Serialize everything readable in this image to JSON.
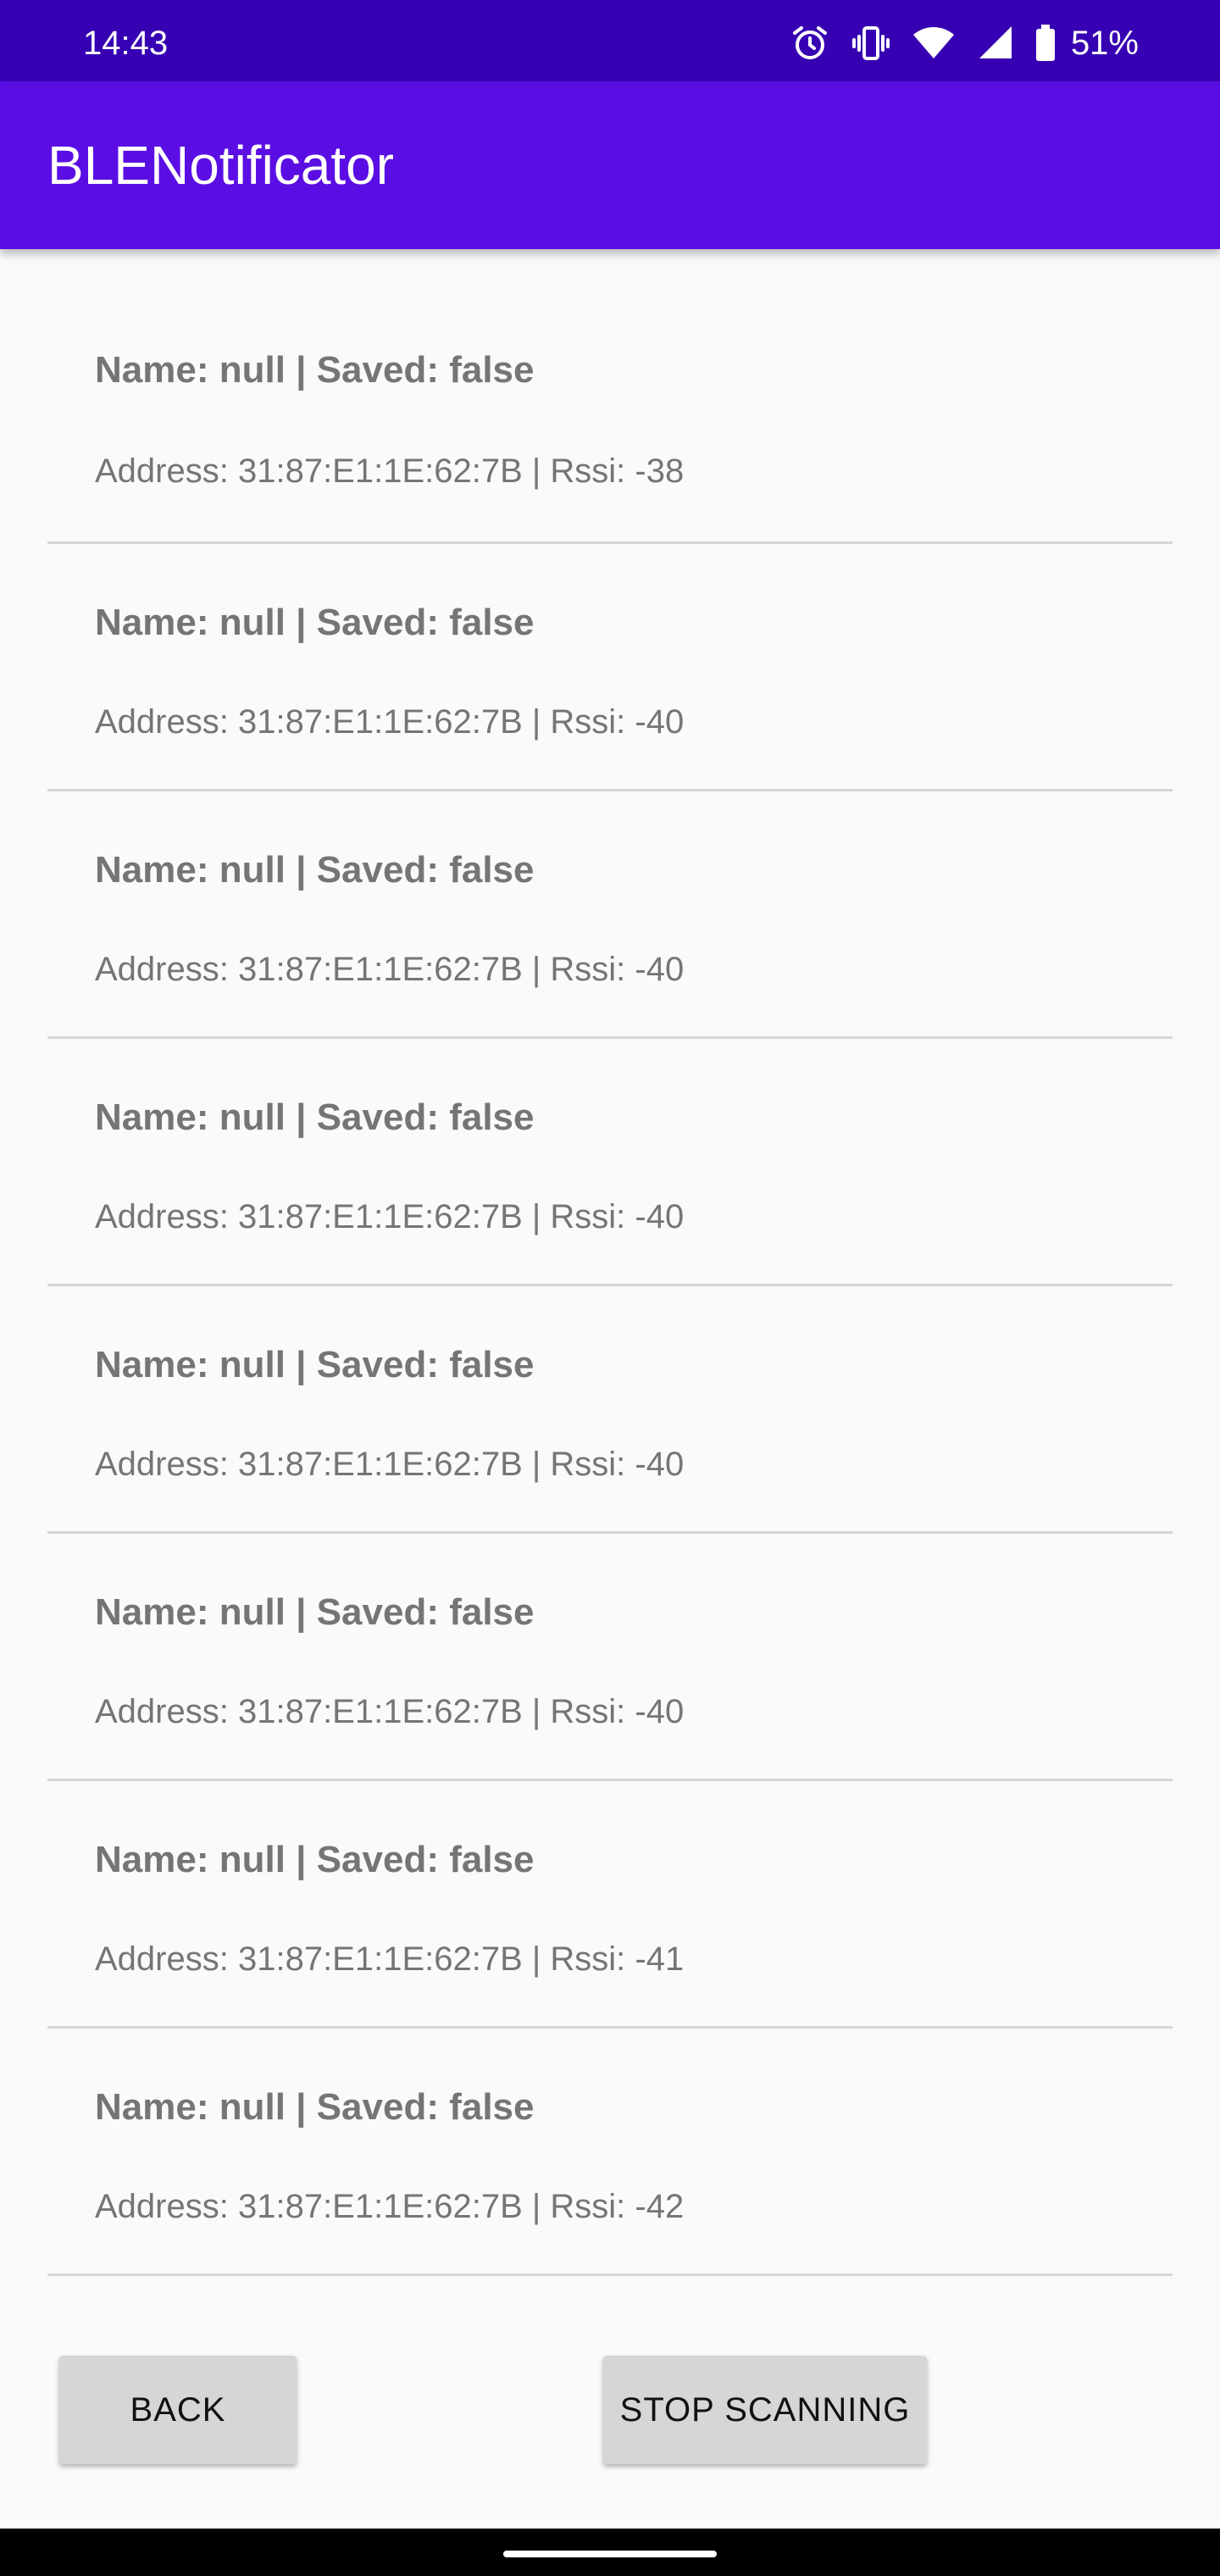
{
  "status_bar": {
    "time": "14:43",
    "battery_percent": "51%",
    "icons": [
      "alarm-icon",
      "vibrate-icon",
      "wifi-icon",
      "cell-signal-icon",
      "battery-icon"
    ]
  },
  "app_bar": {
    "title": "BLENotificator"
  },
  "devices": [
    {
      "name_line": "Name: null | Saved: false",
      "address_line": "Address: 31:87:E1:1E:62:7B | Rssi: -38"
    },
    {
      "name_line": "Name: null | Saved: false",
      "address_line": "Address: 31:87:E1:1E:62:7B | Rssi: -40"
    },
    {
      "name_line": "Name: null | Saved: false",
      "address_line": "Address: 31:87:E1:1E:62:7B | Rssi: -40"
    },
    {
      "name_line": "Name: null | Saved: false",
      "address_line": "Address: 31:87:E1:1E:62:7B | Rssi: -40"
    },
    {
      "name_line": "Name: null | Saved: false",
      "address_line": "Address: 31:87:E1:1E:62:7B | Rssi: -40"
    },
    {
      "name_line": "Name: null | Saved: false",
      "address_line": "Address: 31:87:E1:1E:62:7B | Rssi: -40"
    },
    {
      "name_line": "Name: null | Saved: false",
      "address_line": "Address: 31:87:E1:1E:62:7B | Rssi: -41"
    },
    {
      "name_line": "Name: null | Saved: false",
      "address_line": "Address: 31:87:E1:1E:62:7B | Rssi: -42"
    }
  ],
  "buttons": {
    "back_label": "BACK",
    "stop_label": "STOP SCANNING"
  },
  "colors": {
    "status_bar": "#3700b3",
    "app_bar": "#5b0ee3",
    "button_bg": "#d6d6d6",
    "divider": "#d6d6d6",
    "item_text": "#757575"
  }
}
